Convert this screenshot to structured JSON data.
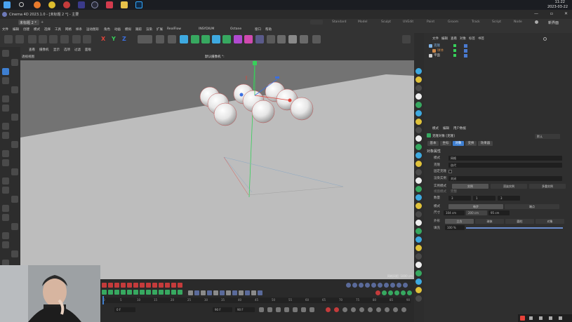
{
  "taskbar": {
    "time": "11:22",
    "date": "2023-03-22"
  },
  "window": {
    "app_title": "Cinema 4D 2023.1.0 - [未标题 2 *] - 主要",
    "doc_tab": "未标题 2 *",
    "layouts": [
      "Standard",
      "Model",
      "Sculpt",
      "UVEdit",
      "Paint",
      "Groom",
      "Track",
      "Script",
      "Node"
    ],
    "new_layout": "新界面"
  },
  "menu": [
    "文件",
    "编辑",
    "创建",
    "模式",
    "选择",
    "工具",
    "网格",
    "样条",
    "运动图形",
    "角色",
    "动画",
    "模拟",
    "跟踪",
    "渲染",
    "扩展",
    "RealFlow",
    "INSYDIUM",
    "Octane",
    "窗口",
    "帮助"
  ],
  "axes": [
    "X",
    "Y",
    "Z"
  ],
  "viewport": {
    "menu": [
      "查看",
      "摄像机",
      "显示",
      "选项",
      "过滤",
      "面板"
    ],
    "name": "透视视图",
    "camera": "默认摄像机 °:",
    "grid_info": "网格间距: 1000 cm"
  },
  "object_manager": {
    "menu": [
      "文件",
      "编辑",
      "查看",
      "对象",
      "标签",
      "书签"
    ],
    "objects": [
      {
        "name": "克隆",
        "color": "#7fb3e6"
      },
      {
        "name": "球体",
        "color": "#d08a4a"
      },
      {
        "name": "平面",
        "color": "#cfcfcf"
      }
    ]
  },
  "attributes": {
    "menu": [
      "模式",
      "编辑",
      "用户数据"
    ],
    "object_name": "克隆对象 [克隆]",
    "dropdown": "默认",
    "tabs": [
      "基本",
      "坐标",
      "对象",
      "变换",
      "效果器"
    ],
    "active_tab": "对象",
    "section": "对象属性",
    "rows": [
      {
        "label": "模式",
        "value": "网格"
      },
      {
        "label": "克隆",
        "value": "迭代"
      },
      {
        "label": "固定克隆",
        "value": ""
      },
      {
        "label": "渲染实例",
        "value": "关闭"
      }
    ],
    "instance_mode_label": "实例模式",
    "instance_modes": [
      "实例",
      "渲染实例",
      "多重实例"
    ],
    "viewport_mode_label": "视窗模式",
    "viewport_mode_value": "完整",
    "count_label": "数量",
    "count": [
      "3",
      "1",
      "3"
    ],
    "mode_label": "模式",
    "modes": [
      "每步",
      "端点"
    ],
    "size_label": "尺寸",
    "size": [
      "104 cm",
      "200 cm",
      "95 cm"
    ],
    "shape_label": "外形",
    "shapes": [
      "立方",
      "球体",
      "圆柱",
      "对象"
    ],
    "fill_label": "填充",
    "fill_value": "100 %",
    "fill_fraction": 1.0
  },
  "timeline": {
    "ticks": [
      "0",
      "5",
      "10",
      "15",
      "20",
      "25",
      "30",
      "35",
      "40",
      "45",
      "50",
      "55",
      "60",
      "65",
      "70",
      "75",
      "80",
      "85",
      "90"
    ],
    "current_frame": "0 F",
    "start": "0 F",
    "end": "90 F",
    "end2": "90 F"
  },
  "colors": {
    "accent": "#3e7fd1",
    "viewport": "#737373",
    "ground": "#bdbdbd",
    "y_axis": "#37d05a",
    "x_axis": "#e0443a",
    "z_axis": "#3b6fe0"
  }
}
